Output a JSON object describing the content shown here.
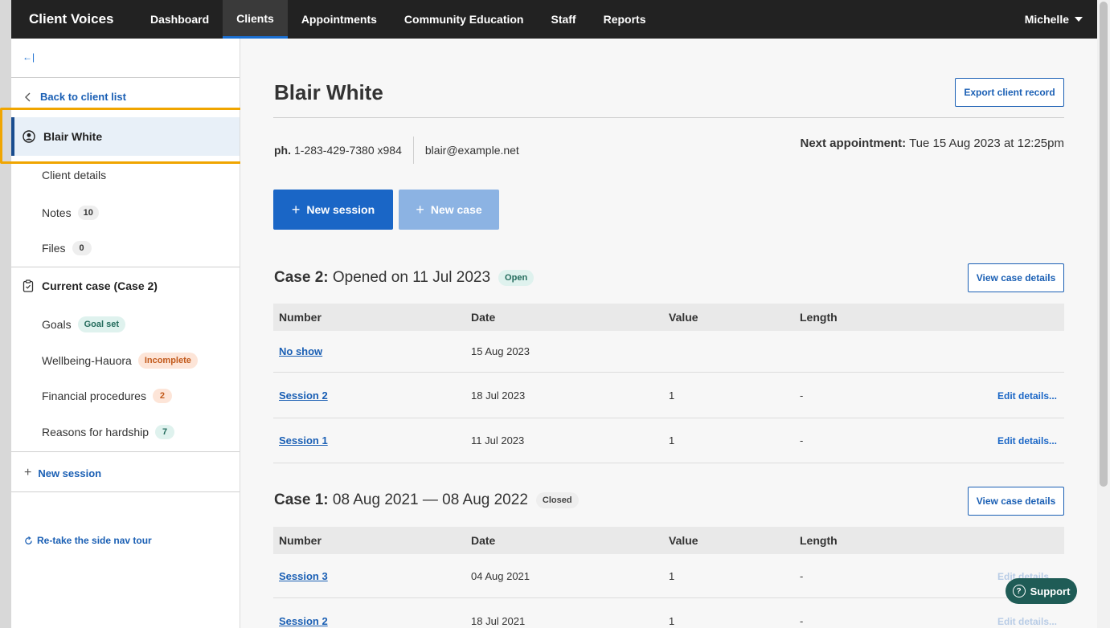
{
  "topbar": {
    "brand": "Client Voices",
    "nav": [
      "Dashboard",
      "Clients",
      "Appointments",
      "Community Education",
      "Staff",
      "Reports"
    ],
    "active": "Clients",
    "user": "Michelle"
  },
  "sidebar": {
    "collapse_icon": "←|",
    "back_link": "Back to client list",
    "client_name": "Blair White",
    "client_details": "Client details",
    "notes_label": "Notes",
    "notes_count": "10",
    "files_label": "Files",
    "files_count": "0",
    "current_case": "Current case (Case 2)",
    "goals_label": "Goals",
    "goals_badge": "Goal set",
    "wellbeing_label": "Wellbeing-Hauora",
    "wellbeing_badge": "Incomplete",
    "financial_label": "Financial procedures",
    "financial_count": "2",
    "reasons_label": "Reasons for hardship",
    "reasons_count": "7",
    "new_session": "New session",
    "retake_tour": "Re-take the side nav tour"
  },
  "client": {
    "name": "Blair White",
    "export_label": "Export client record",
    "phone_prefix": "ph.",
    "phone": "1-283-429-7380 x984",
    "email": "blair@example.net",
    "next_appt_label": "Next appointment:",
    "next_appt_value": "Tue 15 Aug 2023 at 12:25pm"
  },
  "actions": {
    "new_session": "New session",
    "new_case": "New case"
  },
  "table_headers": [
    "Number",
    "Date",
    "Value",
    "Length"
  ],
  "cases": [
    {
      "title_bold": "Case 2:",
      "title_rest": "Opened on 11 Jul 2023",
      "status": "Open",
      "view_label": "View case details",
      "rows": [
        {
          "number": "No show",
          "date": "15 Aug 2023",
          "value": "",
          "length": "",
          "edit": ""
        },
        {
          "number": "Session 2",
          "date": "18 Jul 2023",
          "value": "1",
          "length": "-",
          "edit": "Edit details..."
        },
        {
          "number": "Session 1",
          "date": "11 Jul 2023",
          "value": "1",
          "length": "-",
          "edit": "Edit details..."
        }
      ]
    },
    {
      "title_bold": "Case 1:",
      "title_rest": "08 Aug 2021 — 08 Aug 2022",
      "status": "Closed",
      "view_label": "View case details",
      "rows": [
        {
          "number": "Session 3",
          "date": "04 Aug 2021",
          "value": "1",
          "length": "-",
          "edit": "Edit details..."
        },
        {
          "number": "Session 2",
          "date": "18 Jul 2021",
          "value": "1",
          "length": "-",
          "edit": "Edit details..."
        }
      ]
    }
  ],
  "support": {
    "label": "Support",
    "icon": "?"
  },
  "colors": {
    "topbar": "#222222",
    "accent": "#1a66c6",
    "highlight": "#f0a500",
    "support": "#1f5c56"
  }
}
